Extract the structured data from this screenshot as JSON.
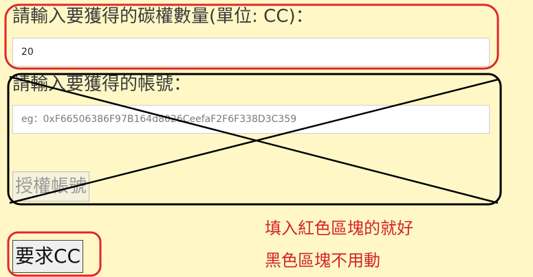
{
  "form": {
    "amount_label": "請輸入要獲得的碳權數量(單位: CC)：",
    "amount_value": "20",
    "account_label": "請輸入要獲得的帳號：",
    "account_placeholder": "eg：0xF66506386F97B164d8026CeefaF2F6F338D3C359",
    "authorize_button_label": "授權帳號",
    "request_button_label": "要求CC"
  },
  "annotations": {
    "note_line1": "填入紅色區塊的就好",
    "note_line2": "黑色區塊不用動",
    "red_outline_color": "#e0262f",
    "black_outline_color": "#000000",
    "note_color": "#d2232a"
  }
}
